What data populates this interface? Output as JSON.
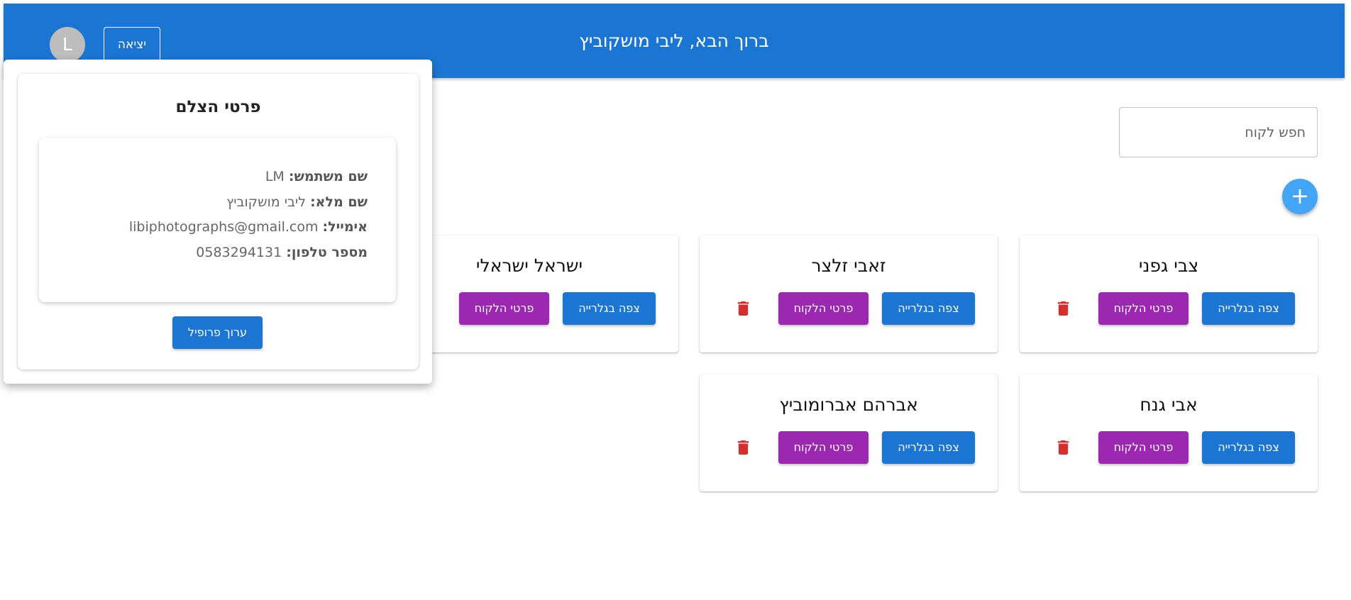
{
  "header": {
    "title": "ברוך הבא, ליבי מושקוביץ",
    "avatar_letter": "L",
    "logout_label": "יציאה"
  },
  "search": {
    "placeholder": "חפש לקוח"
  },
  "fab": {
    "label": "+"
  },
  "buttons": {
    "gallery": "צפה בגלרייה",
    "details": "פרטי הלקוח"
  },
  "clients": [
    {
      "name": "צבי גפני"
    },
    {
      "name": "זאבי זלצר"
    },
    {
      "name": "ישראל ישראלי"
    },
    {
      "name": "אבי גנח"
    },
    {
      "name": "אברהם אברומוביץ"
    }
  ],
  "profile": {
    "title": "פרטי הצלם",
    "username_label": "שם משתמש:",
    "username": "LM",
    "fullname_label": "שם מלא:",
    "fullname": "ליבי מושקוביץ",
    "email_label": "אימייל:",
    "email": "libiphotographs@gmail.com",
    "phone_label": "מספר טלפון:",
    "phone": "0583294131",
    "edit_label": "ערוך פרופיל"
  },
  "colors": {
    "primary": "#1b76d3",
    "secondary": "#9c27b0",
    "fab": "#42a5f5",
    "delete": "#d32f2f"
  }
}
